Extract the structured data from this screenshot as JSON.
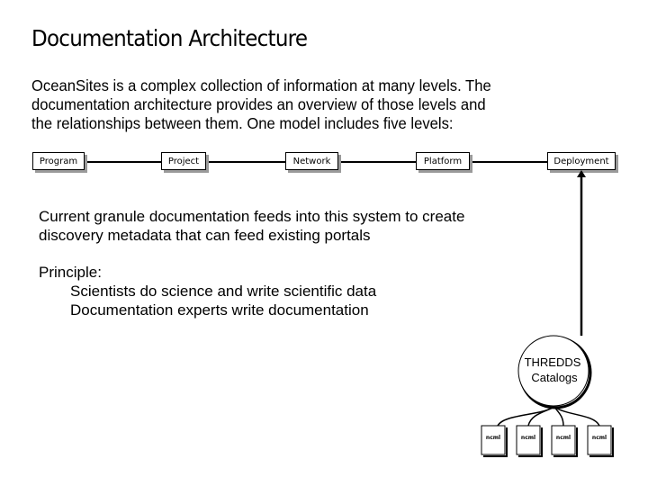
{
  "slide": {
    "title": "Documentation Architecture",
    "intro_lines": [
      "OceanSites is a complex collection of information at many levels. The",
      "documentation architecture provides an overview of those levels and",
      "the relationships between them. One model includes five levels:"
    ],
    "levels": [
      {
        "label": "Program"
      },
      {
        "label": "Project"
      },
      {
        "label": "Network"
      },
      {
        "label": "Platform"
      },
      {
        "label": "Deployment"
      }
    ],
    "granule_text_lines": [
      "Current granule documentation feeds into this system to create",
      "discovery metadata that can feed existing portals"
    ],
    "principle": {
      "heading": "Principle:",
      "items": [
        "Scientists do science and write scientific data",
        "Documentation experts write documentation"
      ]
    },
    "catalog": {
      "line1": "THREDDS",
      "line2": "Catalogs"
    },
    "documents": [
      {
        "label": "ncml"
      },
      {
        "label": "ncml"
      },
      {
        "label": "ncml"
      },
      {
        "label": "ncml"
      }
    ]
  }
}
